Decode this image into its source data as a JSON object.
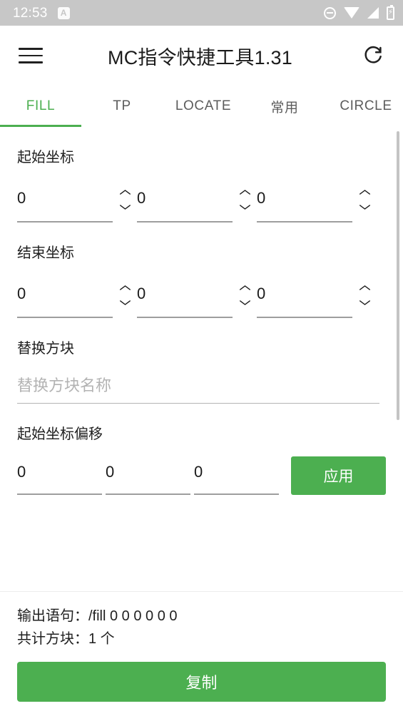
{
  "status_bar": {
    "time": "12:53",
    "notification_icon_letter": "A",
    "icons": [
      "do-not-disturb-icon",
      "wifi-icon",
      "signal-icon",
      "battery-charging-icon"
    ]
  },
  "app_bar": {
    "menu_icon": "hamburger-menu-icon",
    "title": "MC指令快捷工具1.31",
    "refresh_icon": "refresh-icon"
  },
  "tabs": {
    "active_index": 0,
    "items": [
      {
        "label": "FILL"
      },
      {
        "label": "TP"
      },
      {
        "label": "LOCATE"
      },
      {
        "label": "常用"
      },
      {
        "label": "CIRCLE"
      }
    ]
  },
  "form": {
    "start_coords": {
      "label": "起始坐标",
      "values": [
        "0",
        "0",
        "0"
      ]
    },
    "end_coords": {
      "label": "结束坐标",
      "values": [
        "0",
        "0",
        "0"
      ]
    },
    "replace_block": {
      "label": "替换方块",
      "value": "",
      "placeholder": "替换方块名称"
    },
    "start_offset": {
      "label": "起始坐标偏移",
      "values": [
        "0",
        "0",
        "0"
      ],
      "apply_label": "应用"
    }
  },
  "output": {
    "command_line": "输出语句：/fill 0 0 0 0 0 0",
    "total_line": "共计方块：1 个",
    "copy_label": "复制"
  },
  "colors": {
    "accent_green": "#4caf50",
    "status_bar_bg": "#c7c7c7",
    "text_primary": "#1f1f1f",
    "text_inactive_tab": "#5c5c5c",
    "placeholder": "#b3b3b3"
  }
}
